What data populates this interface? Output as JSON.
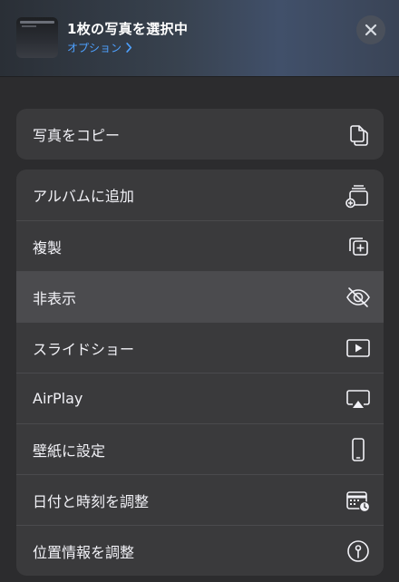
{
  "header": {
    "title": "1枚の写真を選択中",
    "options_label": "オプション",
    "options_icon": "chevron-right-icon",
    "close_icon": "close-icon"
  },
  "colors": {
    "accent": "#4ea1ff",
    "background": "#2c2c2e",
    "row_background": "#3a3a3c",
    "row_highlight": "#4b4b4e"
  },
  "actions": [
    {
      "label": "写真をコピー",
      "icon": "copy-icon"
    },
    {
      "label": "アルバムに追加",
      "icon": "add-to-album-icon"
    },
    {
      "label": "複製",
      "icon": "duplicate-icon"
    },
    {
      "label": "非表示",
      "icon": "eye-slash-icon",
      "highlighted": true
    },
    {
      "label": "スライドショー",
      "icon": "slideshow-play-icon"
    },
    {
      "label": "AirPlay",
      "icon": "airplay-icon"
    },
    {
      "label": "壁紙に設定",
      "icon": "phone-icon"
    },
    {
      "label": "日付と時刻を調整",
      "icon": "calendar-clock-icon"
    },
    {
      "label": "位置情報を調整",
      "icon": "location-info-icon"
    }
  ]
}
